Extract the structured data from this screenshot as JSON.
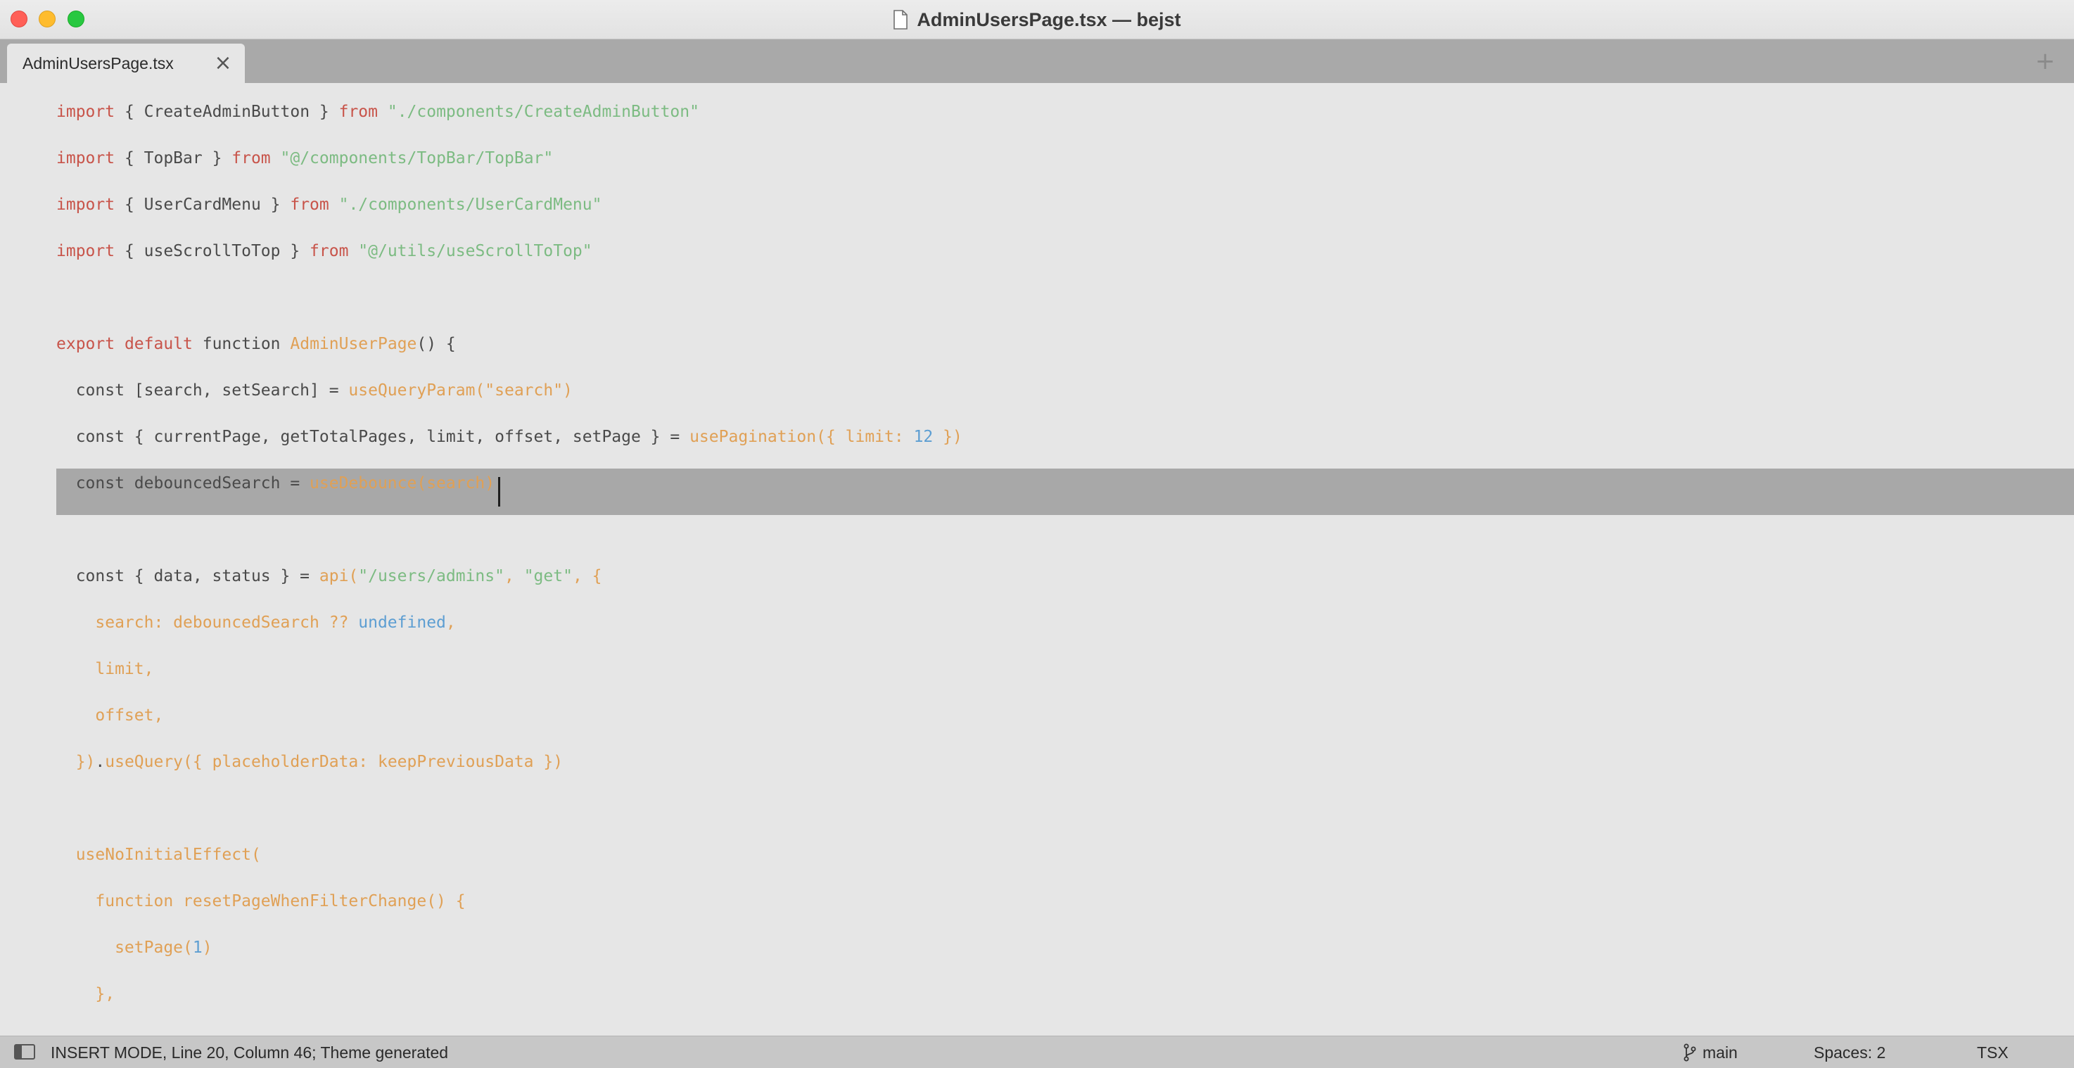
{
  "window": {
    "title": "AdminUsersPage.tsx — bejst"
  },
  "tabs": [
    {
      "label": "AdminUsersPage.tsx",
      "close_icon": "×",
      "active": true
    }
  ],
  "new_tab_icon": "+",
  "editor": {
    "cursor": {
      "line": 20,
      "column": 46
    },
    "lines": [
      [
        [
          "kw",
          "import"
        ],
        [
          "id",
          " { CreateAdminButton } "
        ],
        [
          "kw",
          "from"
        ],
        [
          "id",
          " "
        ],
        [
          "str",
          "\"./components/CreateAdminButton\""
        ]
      ],
      [
        [
          "kw",
          "import"
        ],
        [
          "id",
          " { TopBar } "
        ],
        [
          "kw",
          "from"
        ],
        [
          "id",
          " "
        ],
        [
          "str",
          "\"@/components/TopBar/TopBar\""
        ]
      ],
      [
        [
          "kw",
          "import"
        ],
        [
          "id",
          " { UserCardMenu } "
        ],
        [
          "kw",
          "from"
        ],
        [
          "id",
          " "
        ],
        [
          "str",
          "\"./components/UserCardMenu\""
        ]
      ],
      [
        [
          "kw",
          "import"
        ],
        [
          "id",
          " { useScrollToTop } "
        ],
        [
          "kw",
          "from"
        ],
        [
          "id",
          " "
        ],
        [
          "str",
          "\"@/utils/useScrollToTop\""
        ]
      ],
      [],
      [
        [
          "kw",
          "export"
        ],
        [
          "id",
          " "
        ],
        [
          "kw",
          "default"
        ],
        [
          "id",
          " function "
        ],
        [
          "fn",
          "AdminUserPage"
        ],
        [
          "id",
          "() {"
        ]
      ],
      [
        [
          "id",
          "  const [search, setSearch] = "
        ],
        [
          "fn",
          "useQueryParam(\"search\")"
        ]
      ],
      [
        [
          "id",
          "  const { currentPage, getTotalPages, limit, offset, setPage } = "
        ],
        [
          "fn",
          "usePagination({ limit: "
        ],
        [
          "num",
          "12"
        ],
        [
          "fn",
          " })"
        ]
      ],
      [
        [
          "id",
          "  const debouncedSearch = "
        ],
        [
          "fn",
          "useDebounce(search)"
        ]
      ],
      [],
      [
        [
          "id",
          "  const { data, status } = "
        ],
        [
          "fn",
          "api("
        ],
        [
          "str",
          "\"/users/admins\""
        ],
        [
          "fn",
          ", "
        ],
        [
          "str",
          "\"get\""
        ],
        [
          "fn",
          ", {"
        ]
      ],
      [
        [
          "fn",
          "    search: debouncedSearch ?? "
        ],
        [
          "num",
          "undefined"
        ],
        [
          "fn",
          ","
        ]
      ],
      [
        [
          "fn",
          "    limit,"
        ]
      ],
      [
        [
          "fn",
          "    offset,"
        ]
      ],
      [
        [
          "fn",
          "  })"
        ],
        [
          "id",
          "."
        ],
        [
          "fn",
          "useQuery({ placeholderData: keepPreviousData })"
        ]
      ],
      [],
      [
        [
          "fn",
          "  useNoInitialEffect("
        ]
      ],
      [
        [
          "fn",
          "    function resetPageWhenFilterChange() {"
        ]
      ],
      [
        [
          "fn",
          "      setPage("
        ],
        [
          "num",
          "1"
        ],
        [
          "fn",
          ")"
        ]
      ],
      [
        [
          "fn",
          "    },"
        ]
      ]
    ]
  },
  "statusbar": {
    "sidebar_toggle_icon": "sidebar-toggle-icon",
    "message": "INSERT MODE, Line 20, Column 46; Theme generated",
    "branch": "main",
    "branch_icon": "git-branch-icon",
    "indentation": "Spaces: 2",
    "syntax": "TSX"
  },
  "colors": {
    "keyword": "#c8544a",
    "string": "#7cbb82",
    "function": "#e0a055",
    "number": "#5d9ed2",
    "identifier": "#4a4a4a",
    "editor_bg": "#e6e6e6",
    "tabbar_bg": "#a9a9a9",
    "current_line_bg": "#a8a8a8",
    "statusbar_bg": "#c7c7c7"
  }
}
